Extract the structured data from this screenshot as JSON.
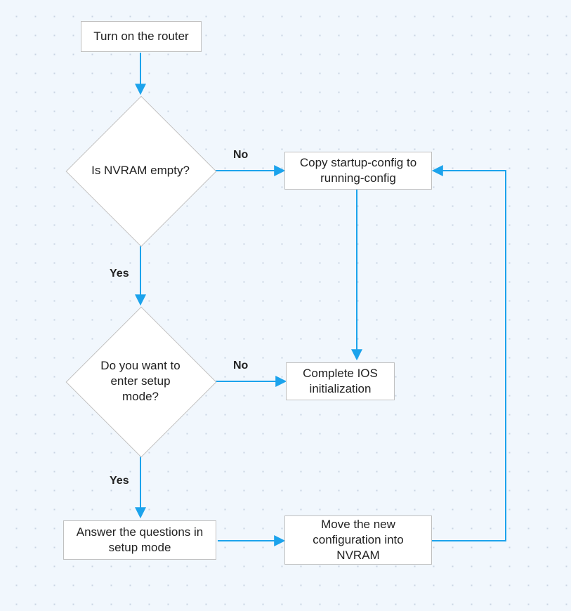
{
  "chart_data": {
    "type": "flowchart",
    "title": "",
    "nodes": [
      {
        "id": "start",
        "kind": "process",
        "label": "Turn on the router"
      },
      {
        "id": "d1",
        "kind": "decision",
        "label": "Is NVRAM empty?"
      },
      {
        "id": "copy",
        "kind": "process",
        "label": "Copy startup-config to running-config"
      },
      {
        "id": "d2",
        "kind": "decision",
        "label": "Do you want to enter setup mode?"
      },
      {
        "id": "ios",
        "kind": "process",
        "label": "Complete IOS initialization"
      },
      {
        "id": "answer",
        "kind": "process",
        "label": "Answer the questions in setup mode"
      },
      {
        "id": "move",
        "kind": "process",
        "label": "Move the new configuration into NVRAM"
      }
    ],
    "edges": [
      {
        "from": "start",
        "to": "d1",
        "label": ""
      },
      {
        "from": "d1",
        "to": "copy",
        "label": "No"
      },
      {
        "from": "d1",
        "to": "d2",
        "label": "Yes"
      },
      {
        "from": "copy",
        "to": "ios",
        "label": ""
      },
      {
        "from": "d2",
        "to": "ios",
        "label": "No"
      },
      {
        "from": "d2",
        "to": "answer",
        "label": "Yes"
      },
      {
        "from": "answer",
        "to": "move",
        "label": ""
      },
      {
        "from": "move",
        "to": "copy",
        "label": ""
      }
    ]
  },
  "labels": {
    "yes": "Yes",
    "no": "No"
  }
}
